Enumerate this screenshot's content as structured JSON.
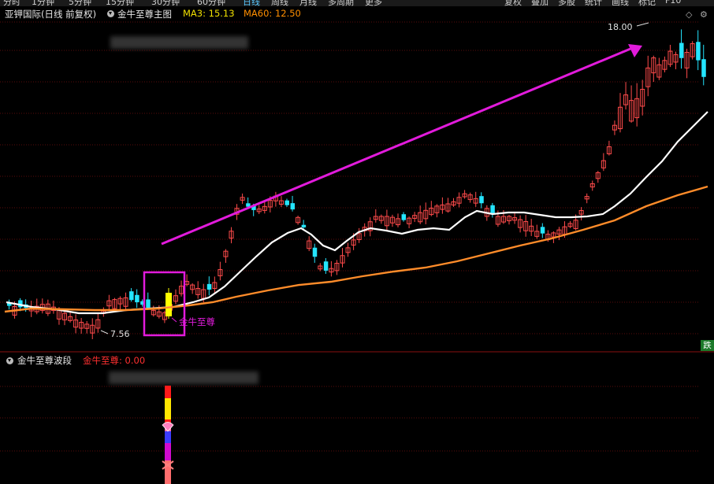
{
  "toolbar": {
    "tabs": [
      "分时",
      "1分钟",
      "5分钟",
      "15分钟",
      "30分钟",
      "60分钟",
      "日线",
      "周线",
      "月线",
      "多周期",
      "更多"
    ],
    "active_tab": "日线",
    "right_tabs": [
      "复权",
      "叠加",
      "多股",
      "统计",
      "画线",
      "标记",
      "F10"
    ]
  },
  "main_panel": {
    "stock_label": "亚钾国际(日线 前复权)",
    "indicator_name": "金牛至尊主图",
    "ma3_label": "MA3: 15.13",
    "ma60_label": "MA60: 12.50",
    "ma3_color": "#f0e000",
    "ma60_color": "#ff8f00",
    "high_label": "18.00",
    "low_label": "7.56",
    "signal_label": "金牛至尊"
  },
  "sub_panel": {
    "indicator_name": "金牛至尊波段",
    "value_label": "金牛至尊: 0.00"
  },
  "badge": "跌",
  "icons": [
    "diamond-icon",
    "gear-icon",
    "dropdown-icon"
  ],
  "colors": {
    "up": "#ff4b4b",
    "down": "#24e5ff",
    "signal_bar": "#ffff00",
    "ma_short": "#ffffff",
    "ma_long": "#ff8c2a",
    "annotation": "#e21bdc"
  },
  "chart_data": {
    "type": "candlestick",
    "price_range_visible": [
      7.56,
      18.0
    ],
    "high": 18.0,
    "low": 7.56,
    "signal": "金牛至尊"
  }
}
